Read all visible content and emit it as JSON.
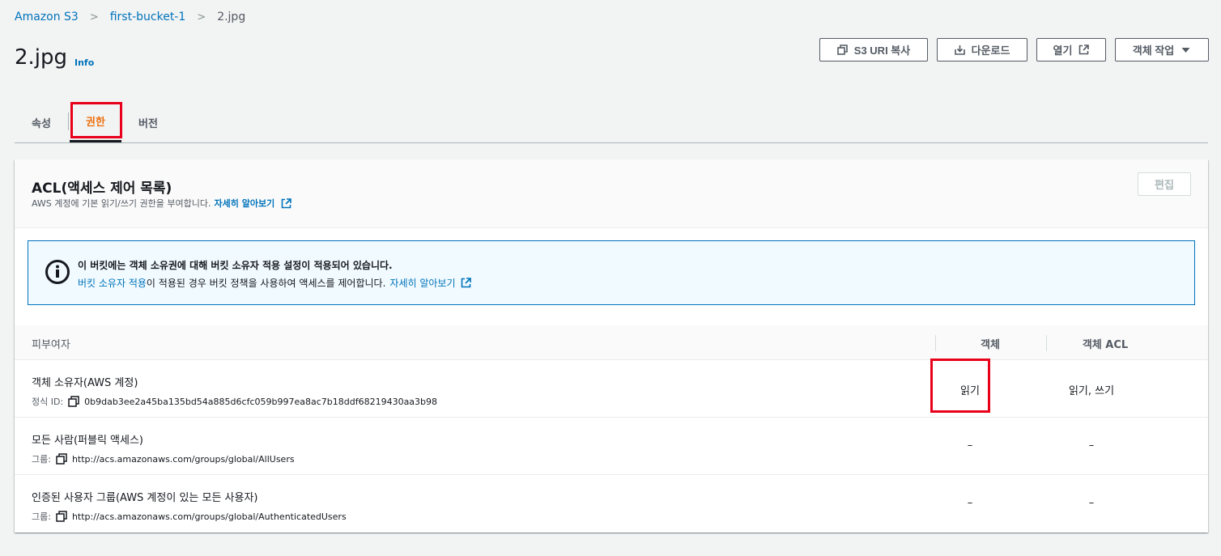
{
  "breadcrumb": {
    "items": [
      "Amazon S3",
      "first-bucket-1"
    ],
    "current": "2.jpg"
  },
  "header": {
    "title": "2.jpg",
    "info": "Info",
    "buttons": {
      "copy_uri": "S3 URI 복사",
      "download": "다운로드",
      "open": "열기",
      "object_actions": "객체 작업"
    }
  },
  "tabs": {
    "properties": "속성",
    "permissions": "권한",
    "versions": "버전"
  },
  "acl": {
    "title": "ACL(액세스 제어 목록)",
    "description": "AWS 계정에 기본 읽기/쓰기 권한을 부여합니다.",
    "learn_more": "자세히 알아보기",
    "edit": "편집"
  },
  "alert": {
    "title": "이 버킷에는 객체 소유권에 대해 버킷 소유자 적용 설정이 적용되어 있습니다.",
    "body_link": "버킷 소유자 적용",
    "body_text": "이 적용된 경우 버킷 정책을 사용하여 액세스를 제어합니다.",
    "learn_more": "자세히 알아보기"
  },
  "table": {
    "headers": {
      "grantee": "피부여자",
      "object": "객체",
      "object_acl": "객체 ACL"
    },
    "rows": [
      {
        "name": "객체 소유자(AWS 계정)",
        "id_label": "정식 ID:",
        "id_value": "0b9dab3ee2a45ba135bd54a885d6cfc059b997ea8ac7b18ddf68219430aa3b98",
        "object": "읽기",
        "object_acl": "읽기, 쓰기"
      },
      {
        "name": "모든 사람(퍼블릭 액세스)",
        "id_label": "그룹:",
        "id_value": "http://acs.amazonaws.com/groups/global/AllUsers",
        "object": "–",
        "object_acl": "–"
      },
      {
        "name": "인증된 사용자 그룹(AWS 계정이 있는 모든 사용자)",
        "id_label": "그룹:",
        "id_value": "http://acs.amazonaws.com/groups/global/AuthenticatedUsers",
        "object": "–",
        "object_acl": "–"
      }
    ]
  },
  "colors": {
    "link": "#0073bb",
    "active_tab": "#ec7211",
    "highlight": "#e8001a",
    "alert_bg": "#f1faff"
  }
}
